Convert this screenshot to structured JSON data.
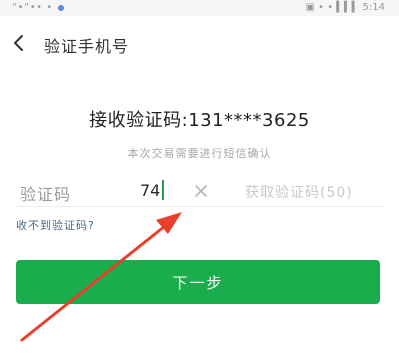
{
  "status_bar": {
    "left_text": "“•“•• •",
    "right_text": "▣ • • ▍▍▍ 5:14"
  },
  "header": {
    "title": "验证手机号",
    "back_icon": "chevron-left-icon"
  },
  "main": {
    "receive_text": "接收验证码:131****3625",
    "sub_text": "本次交易需要进行短信确认",
    "code_field": {
      "label": "验证码",
      "value": "74",
      "clear_icon": "close-icon",
      "resend_label": "获取验证码(50)"
    },
    "no_code_link": "收不到验证码?",
    "next_button": "下一步"
  },
  "colors": {
    "accent_green": "#1aad4e",
    "annotation_red": "#e8402a",
    "link_blue": "#4a6a8a"
  }
}
